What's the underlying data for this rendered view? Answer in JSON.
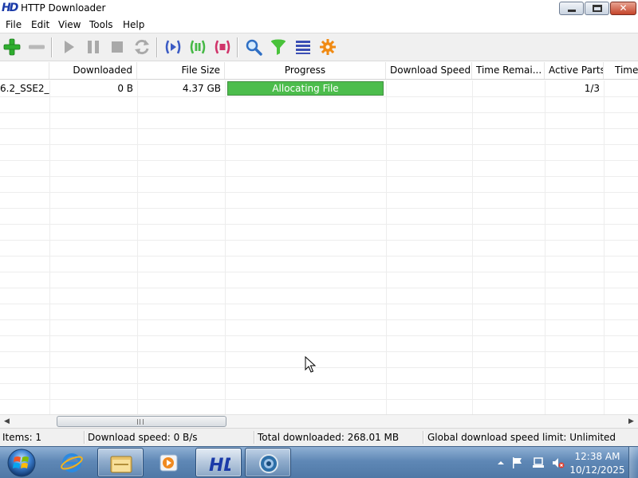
{
  "window": {
    "title": "HTTP Downloader",
    "logo_text": "HD"
  },
  "menu": {
    "items": [
      "File",
      "Edit",
      "View",
      "Tools",
      "Help"
    ]
  },
  "toolbar": {
    "buttons": [
      "add-icon",
      "remove-icon",
      "start-icon",
      "pause-icon",
      "stop-icon",
      "restart-icon",
      "start-all-icon",
      "pause-all-icon",
      "stop-all-icon",
      "search-icon",
      "filter-icon",
      "list-icon",
      "settings-icon"
    ]
  },
  "columns": {
    "downloaded": "Downloaded",
    "file_size": "File Size",
    "progress": "Progress",
    "download_speed": "Download Speed",
    "time_remaining": "Time Remai...",
    "active_parts": "Active Parts",
    "time_elapsed": "Time"
  },
  "rows": [
    {
      "filename": "6.2_SSE2_...",
      "downloaded": "0 B",
      "file_size": "4.37 GB",
      "progress_label": "Allocating File",
      "progress_fraction": 1.0,
      "download_speed": "",
      "time_remaining": "",
      "active_parts": "1/3",
      "time_elapsed": ""
    }
  ],
  "status": {
    "items": "Items: 1",
    "download_speed": "Download speed: 0 B/s",
    "total_downloaded": "Total downloaded: 268.01 MB",
    "speed_limit": "Global download speed limit: Unlimited"
  },
  "taskbar": {
    "apps": [
      "internet-explorer-icon",
      "file-explorer-icon",
      "media-player-icon",
      "http-downloader-icon",
      "browser-icon"
    ],
    "clock_time": "12:38 AM",
    "clock_date": "10/12/2025"
  },
  "colors": {
    "progress_fill": "#4cbd4c",
    "accent_blue": "#1a3aa8"
  }
}
